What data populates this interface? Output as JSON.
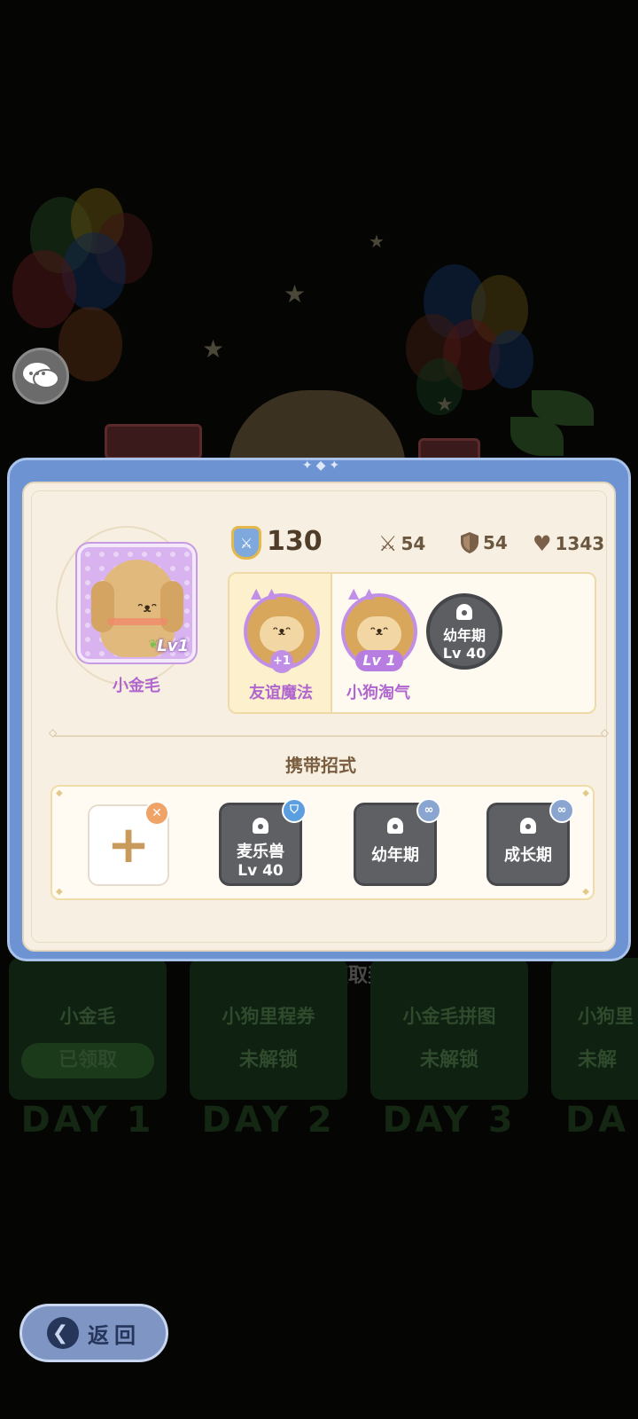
{
  "background": {
    "hint": "点击空白处领取奖励",
    "days": [
      {
        "name": "小金毛",
        "status": "已领取",
        "label": "DAY 1"
      },
      {
        "name": "小狗里程券",
        "status": "未解锁",
        "label": "DAY 2"
      },
      {
        "name": "小金毛拼图",
        "status": "未解锁",
        "label": "DAY 3"
      },
      {
        "name": "小狗里",
        "status": "未解",
        "label": "DA"
      }
    ]
  },
  "pet": {
    "name": "小金毛",
    "level": "Lv1"
  },
  "stats": {
    "power": "130",
    "attack": "54",
    "defense": "54",
    "hp": "1343"
  },
  "skills": [
    {
      "label": "友谊魔法",
      "badge": "+1"
    },
    {
      "label": "小狗淘气",
      "badge": "Lv 1"
    },
    {
      "label": "",
      "locked_line1": "幼年期",
      "locked_line2": "Lv 40"
    }
  ],
  "moves": {
    "title": "携带招式",
    "slots": [
      {
        "line1": "麦乐兽",
        "line2": "Lv 40",
        "badge_color": "#5b9fe0"
      },
      {
        "line1": "幼年期",
        "line2": "",
        "badge_color": "#8aa6d0"
      },
      {
        "line1": "成长期",
        "line2": "",
        "badge_color": "#8aa6d0"
      }
    ]
  },
  "nav": {
    "back_label": "返回"
  },
  "colors": {
    "dialog_frame": "#6d93d2",
    "panel": "#f7f0e2",
    "accent_purple": "#b066cf"
  }
}
